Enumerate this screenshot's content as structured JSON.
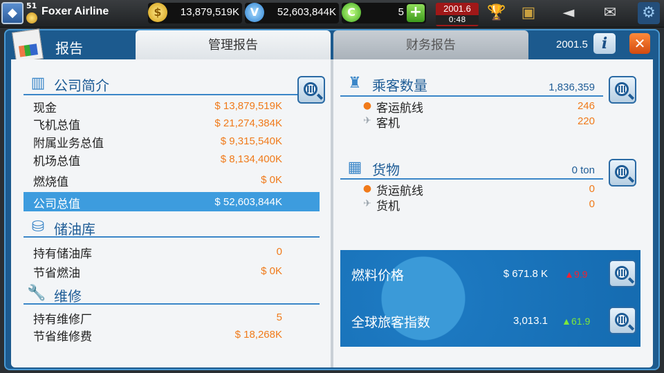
{
  "topbar": {
    "level": "51",
    "airline_name": "Foxer Airline",
    "gold_coins": "13,879,519K",
    "blue_coins": "52,603,844K",
    "green_coins": "5",
    "date": "2001.6",
    "timer": "0:48",
    "icons": [
      "rank-icon",
      "gold-coin-icon",
      "blue-coin-icon",
      "green-coin-icon",
      "plus-icon",
      "trophy-icon",
      "tv-icon",
      "megaphone-icon",
      "mail-icon",
      "settings-icon"
    ]
  },
  "panel": {
    "title": "报告",
    "tabs": [
      {
        "label": "管理报告",
        "active": true
      },
      {
        "label": "财务报告",
        "active": false
      }
    ],
    "period": "2001.5",
    "info_label": "i",
    "close_label": "✕"
  },
  "company": {
    "title": "公司简介",
    "rows": [
      {
        "label": "现金",
        "value": "$ 13,879,519K"
      },
      {
        "label": "飞机总值",
        "value": "$ 21,274,384K"
      },
      {
        "label": "附属业务总值",
        "value": "$ 9,315,540K"
      },
      {
        "label": "机场总值",
        "value": "$ 8,134,400K"
      },
      {
        "label": "燃烧值",
        "value": "$ 0K"
      }
    ],
    "total": {
      "label": "公司总值",
      "value": "$ 52,603,844K"
    }
  },
  "fuel_depot": {
    "title": "储油库",
    "rows": [
      {
        "label": "持有储油库",
        "value": "0"
      },
      {
        "label": "节省燃油",
        "value": "$ 0K"
      }
    ]
  },
  "maintenance": {
    "title": "维修",
    "rows": [
      {
        "label": "持有维修厂",
        "value": "5"
      },
      {
        "label": "节省维修费",
        "value": "$ 18,268K"
      }
    ]
  },
  "passengers": {
    "title": "乘客数量",
    "total": "1,836,359",
    "rows": [
      {
        "label": "客运航线",
        "value": "246"
      },
      {
        "label": "客机",
        "value": "220"
      }
    ]
  },
  "cargo": {
    "title": "货物",
    "total": "0 ton",
    "rows": [
      {
        "label": "货运航线",
        "value": "0"
      },
      {
        "label": "货机",
        "value": "0"
      }
    ]
  },
  "market": {
    "fuel": {
      "label": "燃料价格",
      "value": "$ 671.8 K",
      "delta": "9.9",
      "trend_color": "#e22233"
    },
    "passenger_index": {
      "label": "全球旅客指数",
      "value": "3,013.1",
      "delta": "61.9",
      "trend_color": "#7ee83a"
    }
  }
}
